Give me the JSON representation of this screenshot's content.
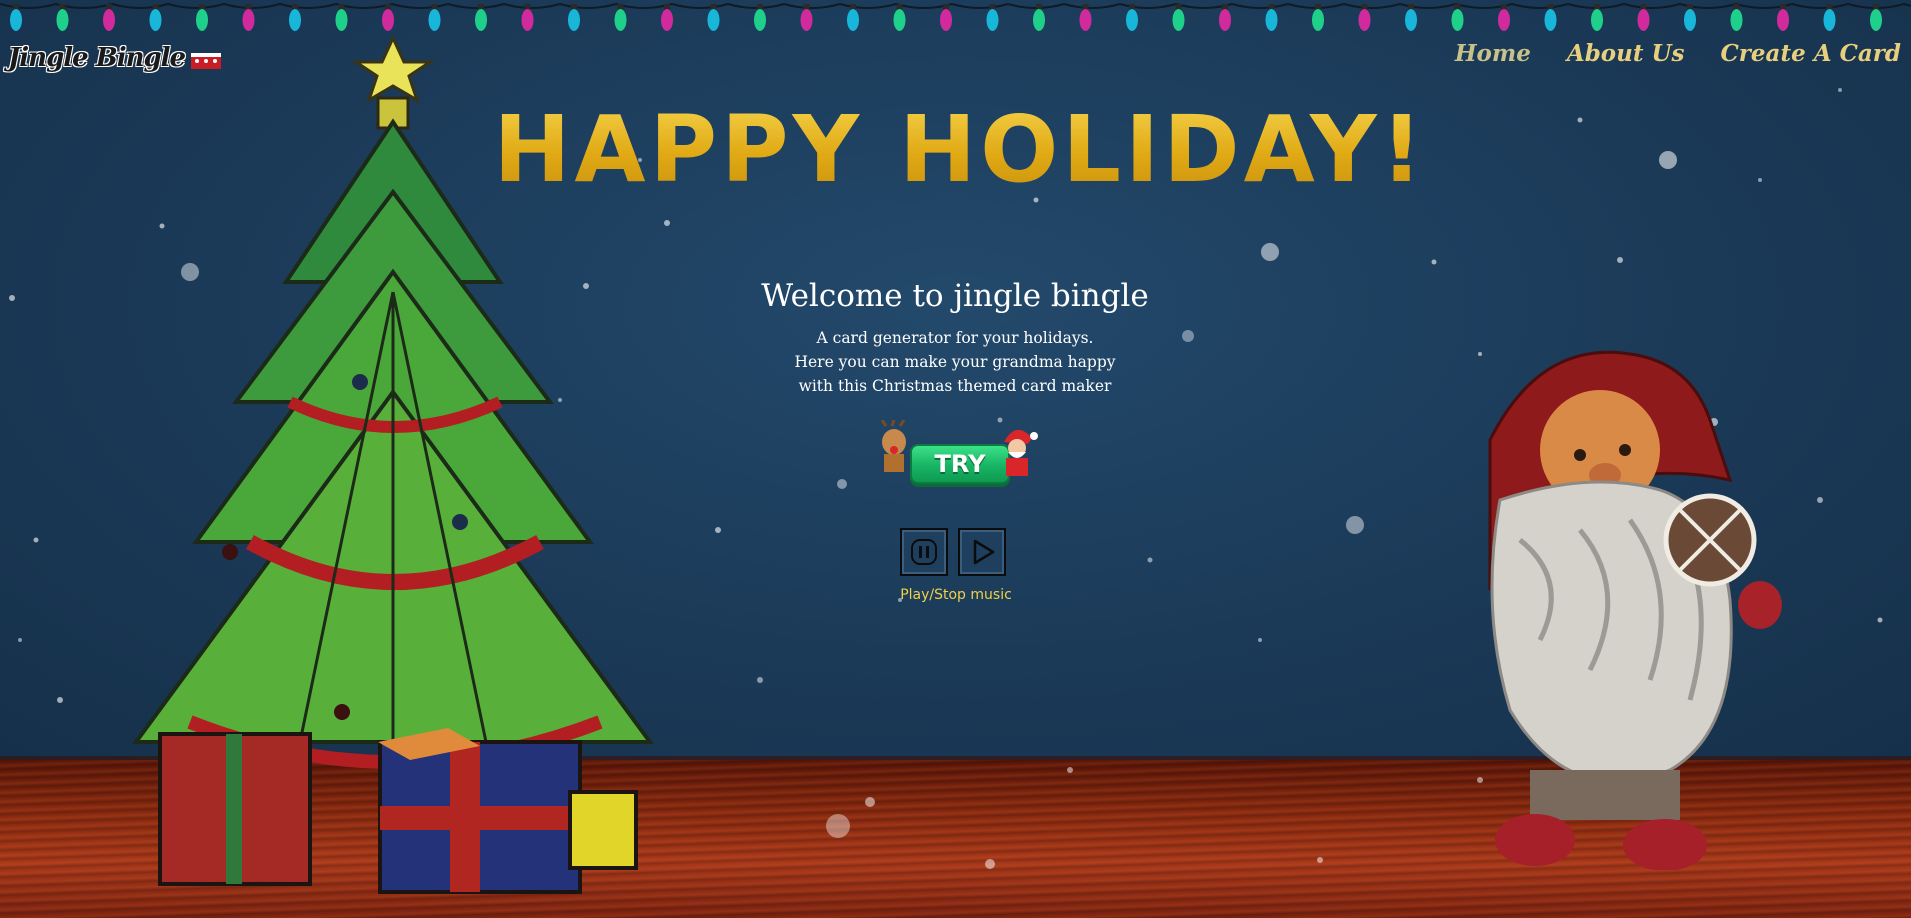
{
  "logo": {
    "text": "Jingle Bingle"
  },
  "nav": {
    "items": [
      {
        "label": "Home"
      },
      {
        "label": "About Us"
      },
      {
        "label": "Create A Card"
      }
    ]
  },
  "hero": {
    "headline": "HAPPY HOLIDAY!",
    "welcome": "Welcome to jingle bingle",
    "desc_line1": "A card generator for your holidays.",
    "desc_line2": "Here you can make your grandma happy",
    "desc_line3": "with this Christmas themed card maker"
  },
  "try_button": {
    "label": "TRY"
  },
  "music": {
    "label": "Play/Stop music",
    "pause_icon": "pause-icon",
    "play_icon": "play-icon"
  },
  "colors": {
    "background": "#1d3d5c",
    "accent_gold": "#e4b21a",
    "nav_text": "#e8cf7d",
    "try_green": "#17b463"
  }
}
